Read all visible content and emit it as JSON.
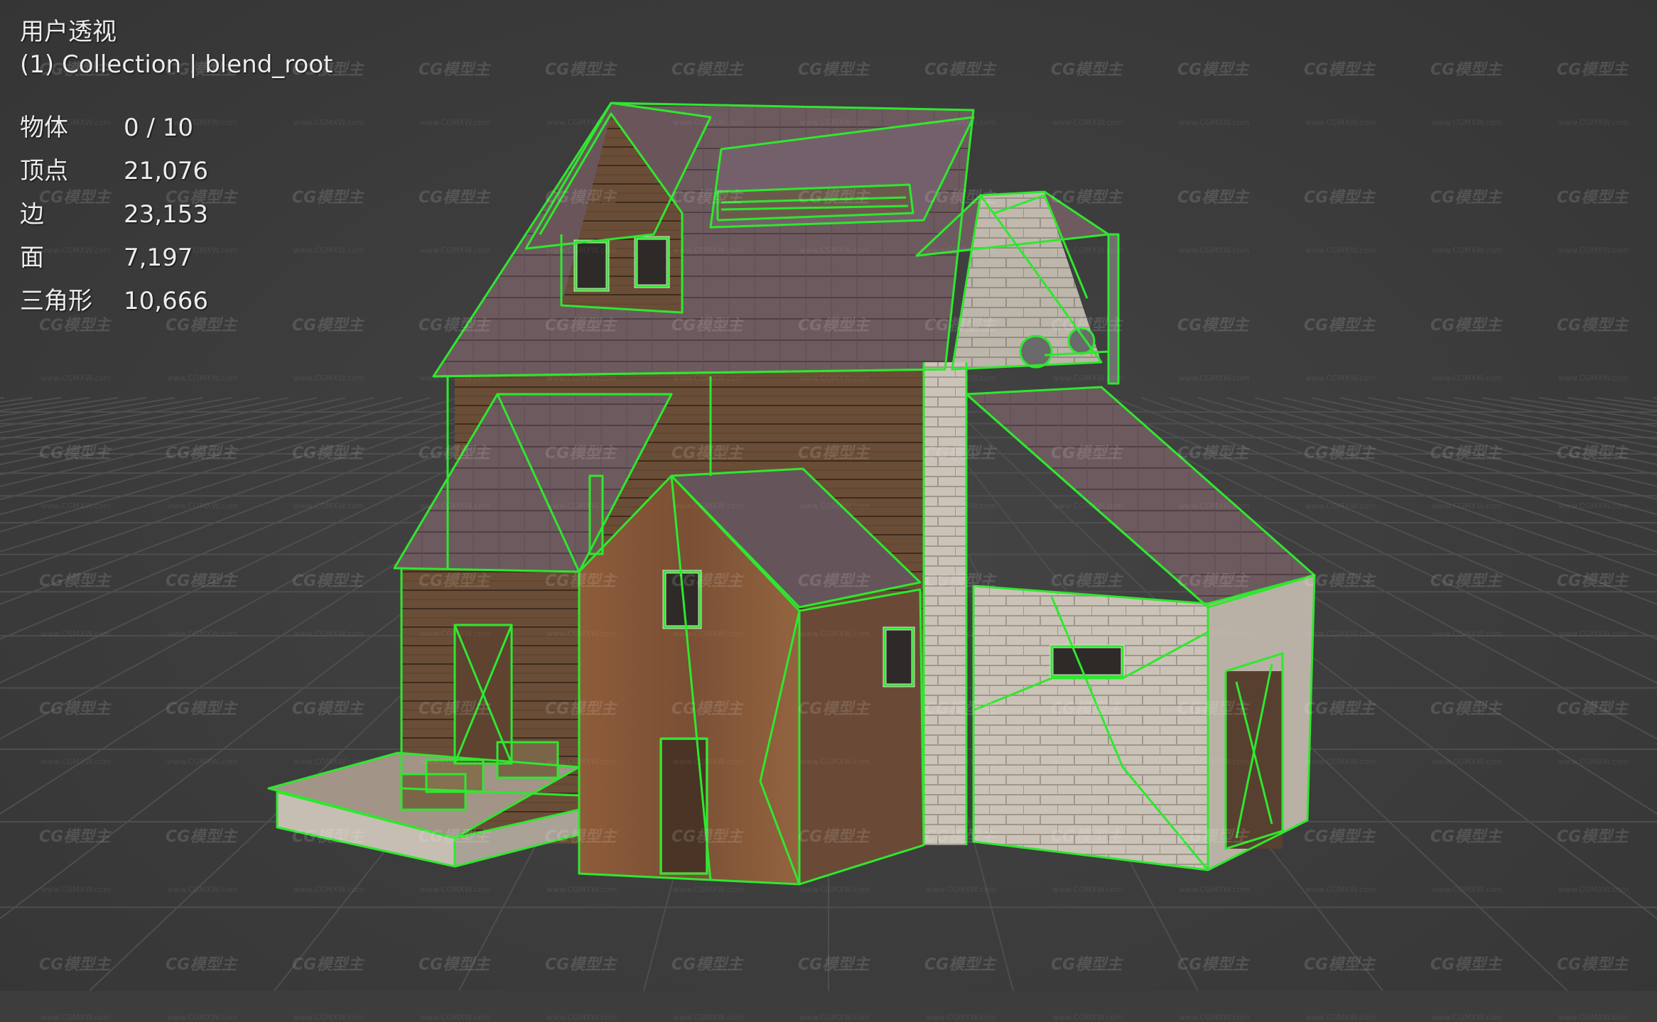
{
  "viewport": {
    "view_name": "用户透视",
    "collection_info": "(1) Collection | blend_root",
    "stats": [
      {
        "label": "物体",
        "value": "0 / 10"
      },
      {
        "label": "顶点",
        "value": "21,076"
      },
      {
        "label": "边",
        "value": "23,153"
      },
      {
        "label": "面",
        "value": "7,197"
      },
      {
        "label": "三角形",
        "value": "10,666"
      }
    ]
  },
  "watermark": {
    "logo_text": "CG模型主",
    "url_text": "www.CGMXW.com"
  },
  "colors": {
    "background": "#3d3d3d",
    "grid": "#505050",
    "wireframe": "#2ee82e",
    "roof": "#6e5a5e",
    "wood": "#6b4e36",
    "rust": "#8a5a38",
    "brick": "#c9c1b5"
  }
}
